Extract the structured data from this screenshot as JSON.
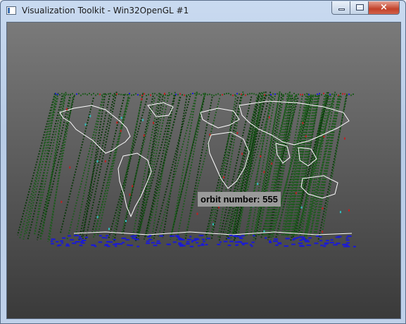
{
  "window": {
    "title": "Visualization Toolkit - Win32OpenGL #1",
    "controls": {
      "minimize": "minimize",
      "maximize": "maximize",
      "close": "×"
    }
  },
  "scene": {
    "caption": "orbit number: 555",
    "colors": {
      "track": "#1f5a1f",
      "track_dark": "#0e3a0e",
      "low_points": "#1a1ad8",
      "highlight_red": "#c02020",
      "highlight_cyan": "#30c0c0",
      "coastline": "#ffffff"
    }
  }
}
